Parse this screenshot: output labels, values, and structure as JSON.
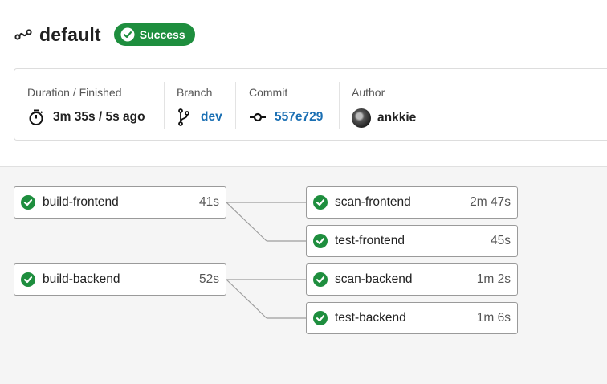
{
  "pipeline": {
    "title": "default",
    "status": "Success",
    "status_color": "#1e8e3e"
  },
  "info": {
    "duration_label": "Duration / Finished",
    "duration_value": "3m 35s / 5s ago",
    "branch_label": "Branch",
    "branch_value": "dev",
    "commit_label": "Commit",
    "commit_value": "557e729",
    "author_label": "Author",
    "author_value": "ankkie"
  },
  "jobs": [
    {
      "name": "build-frontend",
      "duration": "41s",
      "status": "success"
    },
    {
      "name": "build-backend",
      "duration": "52s",
      "status": "success"
    },
    {
      "name": "scan-frontend",
      "duration": "2m 47s",
      "status": "success"
    },
    {
      "name": "test-frontend",
      "duration": "45s",
      "status": "success"
    },
    {
      "name": "scan-backend",
      "duration": "1m 2s",
      "status": "success"
    },
    {
      "name": "test-backend",
      "duration": "1m 6s",
      "status": "success"
    }
  ],
  "icons": {
    "pipeline": "pipeline-icon",
    "status": "check-circle-icon",
    "duration": "stopwatch-icon",
    "branch": "branch-icon",
    "commit": "commit-icon",
    "author": "avatar"
  },
  "colors": {
    "success": "#1e8e3e",
    "link": "#1a6fb3"
  }
}
